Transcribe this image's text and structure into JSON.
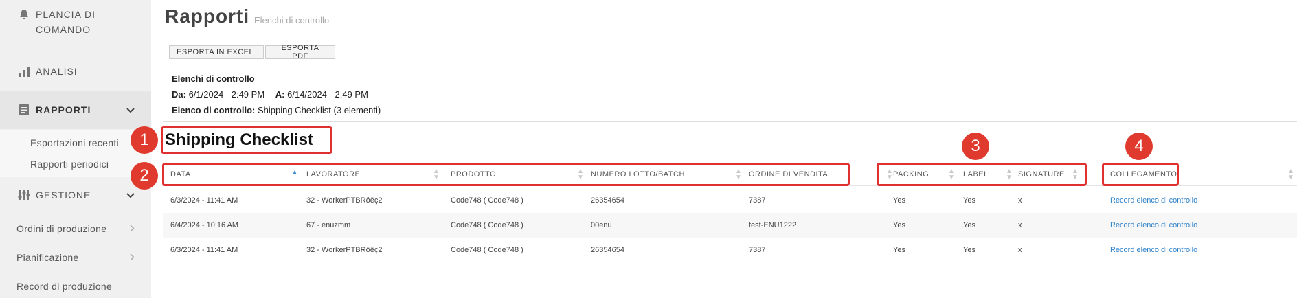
{
  "sidebar": {
    "dashboard": "PLANCIA DI COMANDO",
    "analytics": "ANALISI",
    "reports": "RAPPORTI",
    "reports_sub": [
      "Esportazioni recenti",
      "Rapporti periodici"
    ],
    "management": "GESTIONE",
    "links": [
      "Ordini di produzione",
      "Pianificazione",
      "Record di produzione"
    ]
  },
  "header": {
    "title": "Rapporti",
    "subtitle": "Elenchi di controllo"
  },
  "toolbar": {
    "export_excel": "ESPORTA IN EXCEL",
    "export_pdf": "ESPORTA PDF"
  },
  "info": {
    "heading": "Elenchi di controllo",
    "from_label": "Da:",
    "from_value": "6/1/2024 - 2:49 PM",
    "to_label": "A:",
    "to_value": "6/14/2024 - 2:49 PM",
    "checklist_label": "Elenco di controllo:",
    "checklist_value": "Shipping Checklist (3 elementi)"
  },
  "section_title": "Shipping Checklist",
  "table": {
    "columns": [
      "DATA",
      "LAVORATORE",
      "PRODOTTO",
      "NUMERO LOTTO/BATCH",
      "ORDINE DI VENDITA",
      "PACKING",
      "LABEL",
      "SIGNATURE",
      "COLLEGAMENTO"
    ],
    "rows": [
      [
        "6/3/2024 - 11:41 AM",
        "32 - WorkerPTBRôëç2",
        "Code748 ( Code748 )",
        "26354654",
        "7387",
        "Yes",
        "Yes",
        "x",
        "Record elenco di controllo"
      ],
      [
        "6/4/2024 - 10:16 AM",
        "67 - enuzmm",
        "Code748 ( Code748 )",
        "00enu",
        "test-ENU1222",
        "Yes",
        "Yes",
        "x",
        "Record elenco di controllo"
      ],
      [
        "6/3/2024 - 11:41 AM",
        "32 - WorkerPTBRôëç2",
        "Code748 ( Code748 )",
        "26354654",
        "7387",
        "Yes",
        "Yes",
        "x",
        "Record elenco di controllo"
      ]
    ]
  },
  "annotations": [
    "1",
    "2",
    "3",
    "4"
  ],
  "colors": {
    "annotation": "#e03030",
    "link": "#2f82c9",
    "sort_active": "#3a8fd6"
  },
  "icons": [
    "bell-icon",
    "bar-chart-icon",
    "document-icon",
    "sliders-icon",
    "chevron-down-icon",
    "chevron-right-icon",
    "sort-icon"
  ]
}
